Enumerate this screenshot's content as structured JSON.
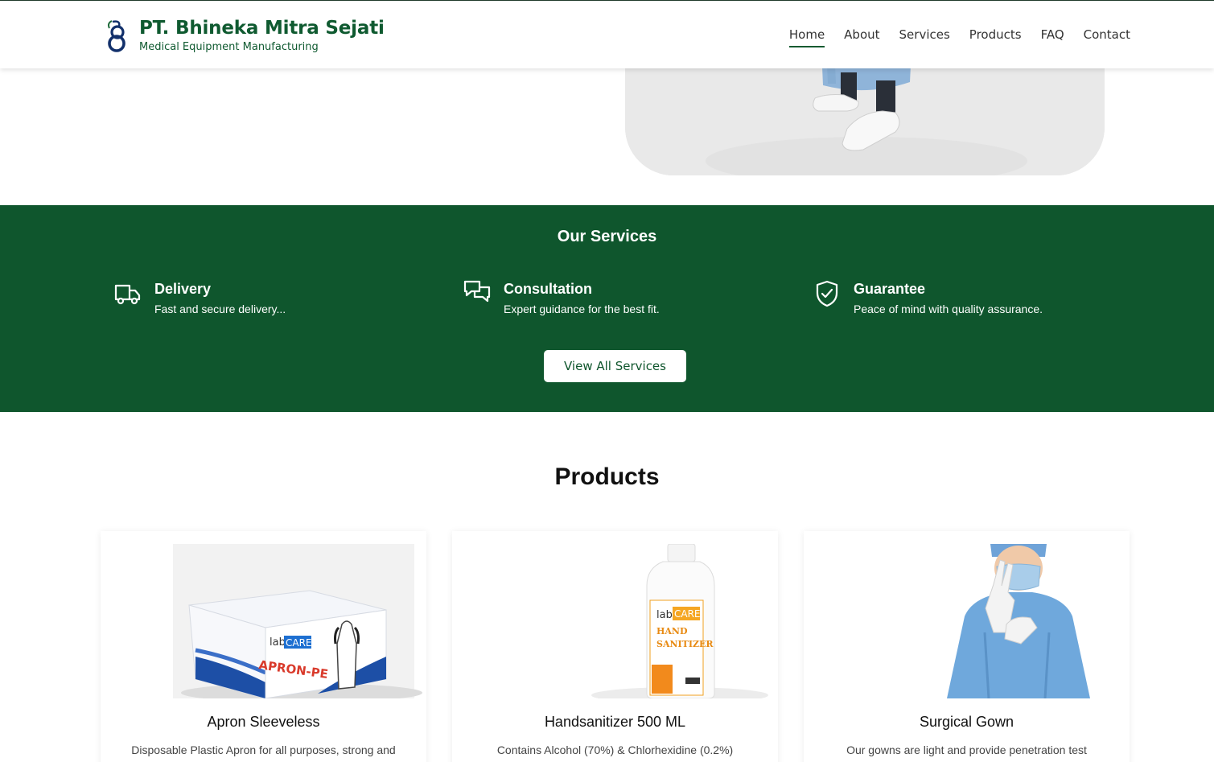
{
  "brand": {
    "name": "PT. Bhineka Mitra Sejati",
    "tagline": "Medical Equipment Manufacturing"
  },
  "nav": {
    "items": [
      "Home",
      "About",
      "Services",
      "Products",
      "FAQ",
      "Contact"
    ],
    "active": "Home"
  },
  "services": {
    "title": "Our Services",
    "items": [
      {
        "name": "Delivery",
        "desc": "Fast and secure delivery...",
        "icon": "truck-icon"
      },
      {
        "name": "Consultation",
        "desc": "Expert guidance for the best fit.",
        "icon": "chat-icon"
      },
      {
        "name": "Guarantee",
        "desc": "Peace of mind with quality assurance.",
        "icon": "shield-check-icon"
      }
    ],
    "button_label": "View All Services"
  },
  "products": {
    "title": "Products",
    "items": [
      {
        "name": "Apron Sleeveless",
        "desc": "Disposable Plastic Apron for all purposes, strong and",
        "box_brand": "lab",
        "box_brand_accent": "CARE",
        "box_product": "APRON-PE"
      },
      {
        "name": "Handsanitizer 500 ML",
        "desc": "Contains Alcohol (70%) & Chlorhexidine (0.2%)",
        "bottle_brand": "lab",
        "bottle_brand_accent": "CARE",
        "bottle_line1": "HAND",
        "bottle_line2": "SANITIZER"
      },
      {
        "name": "Surgical Gown",
        "desc": "Our gowns are light and provide penetration test AATCC"
      }
    ]
  },
  "colors": {
    "primary_green": "#0f562d",
    "brand_green": "#0f5a30"
  }
}
